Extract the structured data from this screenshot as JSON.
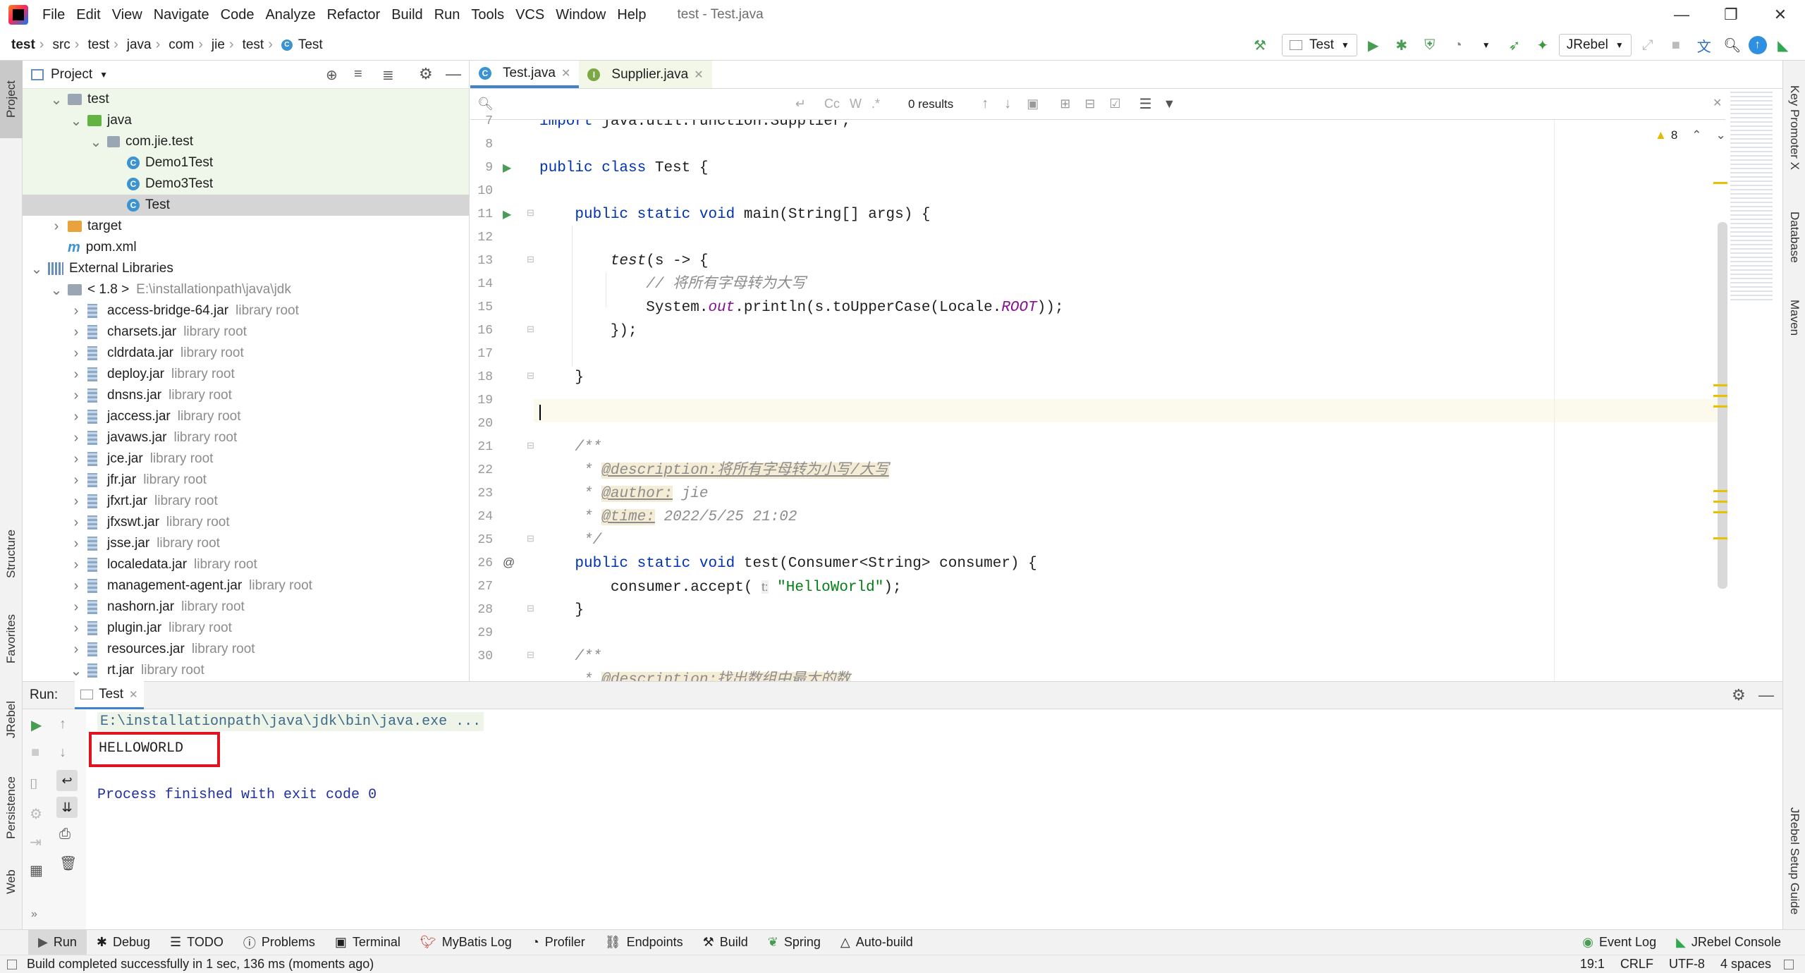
{
  "menu": {
    "items": [
      "File",
      "Edit",
      "View",
      "Navigate",
      "Code",
      "Analyze",
      "Refactor",
      "Build",
      "Run",
      "Tools",
      "VCS",
      "Window",
      "Help"
    ],
    "window_title": "test - Test.java"
  },
  "breadcrumb": [
    "test",
    "src",
    "test",
    "java",
    "com",
    "jie",
    "test",
    "Test"
  ],
  "toolbar": {
    "run_config": "Test",
    "jrebel": "JRebel"
  },
  "left_strip": {
    "project": "Project",
    "structure": "Structure",
    "favorites": "Favorites",
    "jrebel": "JRebel",
    "persistence": "Persistence",
    "web": "Web"
  },
  "right_strip": {
    "key_promoter": "Key Promoter X",
    "database": "Database",
    "maven": "Maven",
    "jrebel_guide": "JRebel Setup Guide"
  },
  "project_panel": {
    "title": "Project",
    "rows": [
      {
        "label": "test",
        "dim": "",
        "kind": "folder",
        "indent": 1,
        "arrow": "v"
      },
      {
        "label": "java",
        "dim": "",
        "kind": "folder-green",
        "indent": 2,
        "arrow": "v"
      },
      {
        "label": "com.jie.test",
        "dim": "",
        "kind": "package",
        "indent": 3,
        "arrow": "v"
      },
      {
        "label": "Demo1Test",
        "dim": "",
        "kind": "class",
        "indent": 4,
        "arrow": ""
      },
      {
        "label": "Demo3Test",
        "dim": "",
        "kind": "class",
        "indent": 4,
        "arrow": ""
      },
      {
        "label": "Test",
        "dim": "",
        "kind": "class",
        "indent": 4,
        "arrow": "",
        "selected": true
      },
      {
        "label": "target",
        "dim": "",
        "kind": "folder-orange",
        "indent": 1,
        "arrow": ">"
      },
      {
        "label": "pom.xml",
        "dim": "",
        "kind": "maven",
        "indent": 1,
        "arrow": ""
      },
      {
        "label": "External Libraries",
        "dim": "",
        "kind": "lib",
        "indent": 0,
        "arrow": "v"
      },
      {
        "label": "< 1.8 >",
        "dim": "E:\\installationpath\\java\\jdk",
        "kind": "folder",
        "indent": 1,
        "arrow": "v"
      },
      {
        "label": "access-bridge-64.jar",
        "dim": "library root",
        "kind": "jar",
        "indent": 2,
        "arrow": ">"
      },
      {
        "label": "charsets.jar",
        "dim": "library root",
        "kind": "jar",
        "indent": 2,
        "arrow": ">"
      },
      {
        "label": "cldrdata.jar",
        "dim": "library root",
        "kind": "jar",
        "indent": 2,
        "arrow": ">"
      },
      {
        "label": "deploy.jar",
        "dim": "library root",
        "kind": "jar",
        "indent": 2,
        "arrow": ">"
      },
      {
        "label": "dnsns.jar",
        "dim": "library root",
        "kind": "jar",
        "indent": 2,
        "arrow": ">"
      },
      {
        "label": "jaccess.jar",
        "dim": "library root",
        "kind": "jar",
        "indent": 2,
        "arrow": ">"
      },
      {
        "label": "javaws.jar",
        "dim": "library root",
        "kind": "jar",
        "indent": 2,
        "arrow": ">"
      },
      {
        "label": "jce.jar",
        "dim": "library root",
        "kind": "jar",
        "indent": 2,
        "arrow": ">"
      },
      {
        "label": "jfr.jar",
        "dim": "library root",
        "kind": "jar",
        "indent": 2,
        "arrow": ">"
      },
      {
        "label": "jfxrt.jar",
        "dim": "library root",
        "kind": "jar",
        "indent": 2,
        "arrow": ">"
      },
      {
        "label": "jfxswt.jar",
        "dim": "library root",
        "kind": "jar",
        "indent": 2,
        "arrow": ">"
      },
      {
        "label": "jsse.jar",
        "dim": "library root",
        "kind": "jar",
        "indent": 2,
        "arrow": ">"
      },
      {
        "label": "localedata.jar",
        "dim": "library root",
        "kind": "jar",
        "indent": 2,
        "arrow": ">"
      },
      {
        "label": "management-agent.jar",
        "dim": "library root",
        "kind": "jar",
        "indent": 2,
        "arrow": ">"
      },
      {
        "label": "nashorn.jar",
        "dim": "library root",
        "kind": "jar",
        "indent": 2,
        "arrow": ">"
      },
      {
        "label": "plugin.jar",
        "dim": "library root",
        "kind": "jar",
        "indent": 2,
        "arrow": ">"
      },
      {
        "label": "resources.jar",
        "dim": "library root",
        "kind": "jar",
        "indent": 2,
        "arrow": ">"
      },
      {
        "label": "rt.jar",
        "dim": "library root",
        "kind": "jar",
        "indent": 2,
        "arrow": "v"
      }
    ]
  },
  "editor": {
    "tabs": [
      {
        "label": "Test.java",
        "active": true
      },
      {
        "label": "Supplier.java",
        "active": false
      }
    ],
    "find": {
      "results": "0 results",
      "cc": "Cc",
      "w": "W",
      "regex": ".*"
    },
    "warnings": "8",
    "line_numbers": [
      "7",
      "8",
      "9",
      "10",
      "11",
      "12",
      "13",
      "14",
      "15",
      "16",
      "17",
      "18",
      "19",
      "20",
      "21",
      "22",
      "23",
      "24",
      "25",
      "26",
      "27",
      "28",
      "29",
      "30"
    ]
  },
  "run_panel": {
    "title": "Run:",
    "tab": "Test",
    "console": {
      "cmd": "E:\\installationpath\\java\\jdk\\bin\\java.exe ...",
      "output": "HELLOWORLD",
      "exit": "Process finished with exit code 0"
    }
  },
  "bottom_tabs": [
    "Run",
    "Debug",
    "TODO",
    "Problems",
    "Terminal",
    "MyBatis Log",
    "Profiler",
    "Endpoints",
    "Build",
    "Spring",
    "Auto-build"
  ],
  "bottom_right": {
    "event_log": "Event Log",
    "jrebel_console": "JRebel Console"
  },
  "status": {
    "message": "Build completed successfully in 1 sec, 136 ms (moments ago)",
    "position": "19:1",
    "line_sep": "CRLF",
    "encoding": "UTF-8",
    "indent": "4 spaces"
  },
  "colors": {
    "accent": "#4083c9",
    "highlight_box": "#e0141e",
    "run_green": "#499c54"
  }
}
